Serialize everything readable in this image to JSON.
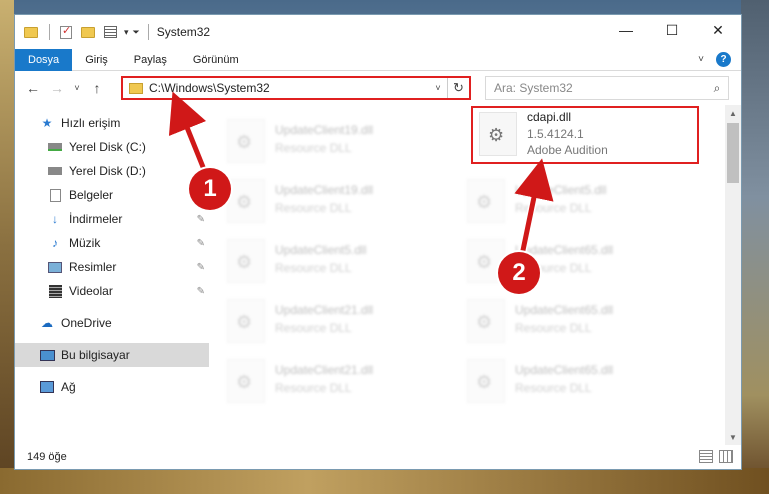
{
  "window": {
    "title": "System32",
    "buttons": {
      "minimize": "—",
      "maximize": "☐",
      "close": "✕"
    }
  },
  "ribbon": {
    "tabs": [
      {
        "label": "Dosya",
        "active": true
      },
      {
        "label": "Giriş"
      },
      {
        "label": "Paylaş"
      },
      {
        "label": "Görünüm"
      }
    ],
    "help": "?"
  },
  "nav": {
    "back": "←",
    "forward": "→",
    "recent": "˅",
    "up": "↑",
    "address": "C:\\Windows\\System32",
    "address_caret": "˅",
    "refresh": "↻",
    "search_placeholder": "Ara: System32",
    "search_icon": "⌕"
  },
  "sidebar": {
    "items": [
      {
        "label": "Hızlı erişim",
        "icon": "star-icon"
      },
      {
        "label": "Yerel Disk (C:)",
        "icon": "drive-icon"
      },
      {
        "label": "Yerel Disk (D:)",
        "icon": "drive-icon"
      },
      {
        "label": "Belgeler",
        "icon": "documents-icon"
      },
      {
        "label": "İndirmeler",
        "icon": "download-icon",
        "pinned": true
      },
      {
        "label": "Müzik",
        "icon": "music-icon",
        "pinned": true
      },
      {
        "label": "Resimler",
        "icon": "pictures-icon",
        "pinned": true
      },
      {
        "label": "Videolar",
        "icon": "videos-icon",
        "pinned": true
      },
      {
        "label": "OneDrive",
        "icon": "cloud-icon"
      },
      {
        "label": "Bu bilgisayar",
        "icon": "computer-icon",
        "selected": true
      },
      {
        "label": "Ağ",
        "icon": "network-icon"
      }
    ]
  },
  "files": {
    "left_column": [
      {
        "name": "UpdateClient19.dll",
        "desc": "Resource DLL"
      },
      {
        "name": "UpdateClient19.dll",
        "desc": "Resource DLL"
      },
      {
        "name": "UpdateClient5.dll",
        "desc": "Resource DLL"
      },
      {
        "name": "UpdateClient21.dll",
        "desc": "Resource DLL"
      },
      {
        "name": "UpdateClient21.dll",
        "desc": "Resource DLL"
      }
    ],
    "highlighted": {
      "name": "cdapi.dll",
      "version": "1.5.4124.1",
      "desc": "Adobe Audition"
    },
    "right_column": [
      {
        "name": "UpdateClient5.dll",
        "desc": "Resource DLL"
      },
      {
        "name": "UpdateClient65.dll",
        "desc": "Resource DLL"
      },
      {
        "name": "UpdateClient65.dll",
        "desc": "Resource DLL"
      },
      {
        "name": "UpdateClient65.dll",
        "desc": "Resource DLL"
      }
    ]
  },
  "status": {
    "item_count": "149 öğe"
  },
  "annotations": {
    "callout_1": "1",
    "callout_2": "2",
    "highlight_color": "#e02020",
    "callout_color": "#d01818"
  },
  "colors": {
    "accent": "#1979ca",
    "selected_bg": "#d9d9d9"
  }
}
